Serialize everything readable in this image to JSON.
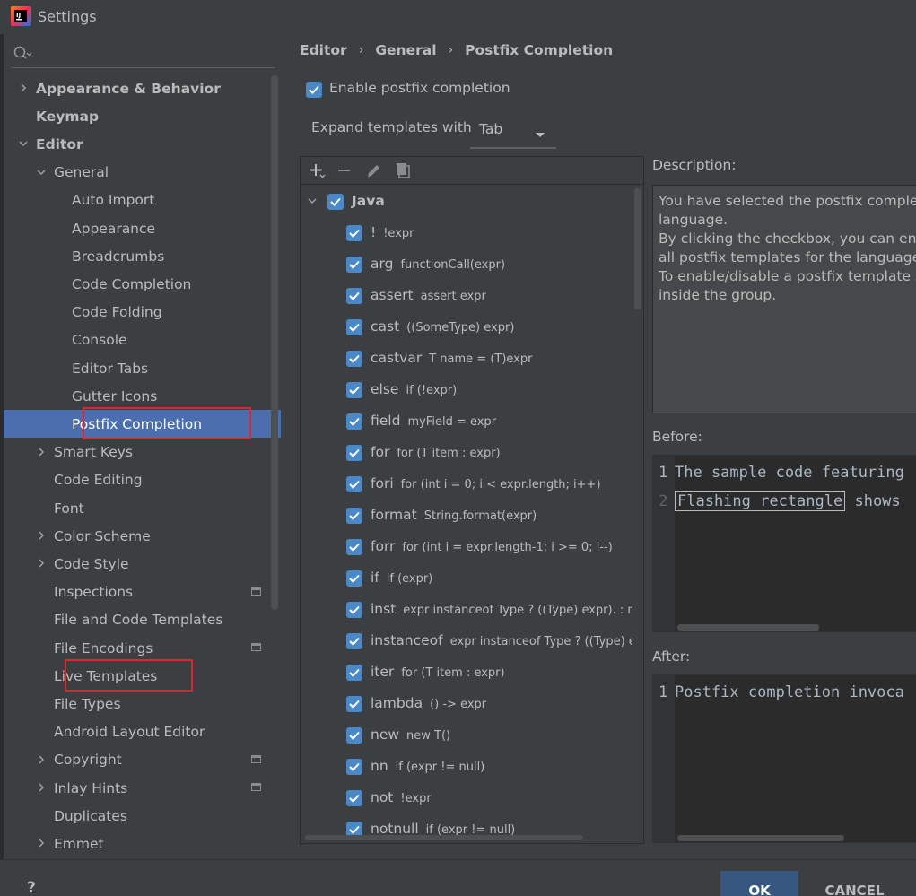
{
  "window": {
    "title": "Settings",
    "app_icon": "intellij-idea-icon"
  },
  "search": {
    "placeholder": "",
    "icon": "search-icon"
  },
  "tree": {
    "items": [
      {
        "label": "Appearance & Behavior",
        "bold": true,
        "expandable": true,
        "expanded": false
      },
      {
        "label": "Keymap",
        "bold": true,
        "expandable": false
      },
      {
        "label": "Editor",
        "bold": true,
        "expandable": true,
        "expanded": true
      },
      {
        "label": "General",
        "expandable": true,
        "expanded": true
      },
      {
        "label": "Auto Import"
      },
      {
        "label": "Appearance"
      },
      {
        "label": "Breadcrumbs"
      },
      {
        "label": "Code Completion"
      },
      {
        "label": "Code Folding"
      },
      {
        "label": "Console"
      },
      {
        "label": "Editor Tabs"
      },
      {
        "label": "Gutter Icons"
      },
      {
        "label": "Postfix Completion",
        "selected": true,
        "highlighted": true
      },
      {
        "label": "Smart Keys",
        "expandable": true,
        "expanded": false
      },
      {
        "label": "Code Editing"
      },
      {
        "label": "Font"
      },
      {
        "label": "Color Scheme",
        "expandable": true,
        "expanded": false
      },
      {
        "label": "Code Style",
        "expandable": true,
        "expanded": false
      },
      {
        "label": "Inspections",
        "badge": true
      },
      {
        "label": "File and Code Templates"
      },
      {
        "label": "File Encodings",
        "badge": true
      },
      {
        "label": "Live Templates",
        "highlighted": true
      },
      {
        "label": "File Types"
      },
      {
        "label": "Android Layout Editor"
      },
      {
        "label": "Copyright",
        "expandable": true,
        "expanded": false,
        "badge": true
      },
      {
        "label": "Inlay Hints",
        "expandable": true,
        "expanded": false,
        "badge": true
      },
      {
        "label": "Duplicates"
      },
      {
        "label": "Emmet",
        "expandable": true,
        "expanded": false
      }
    ]
  },
  "breadcrumb": [
    "Editor",
    "General",
    "Postfix Completion"
  ],
  "enable_postfix": {
    "label": "Enable postfix completion",
    "checked": true
  },
  "expand": {
    "label": "Expand templates with",
    "value": "Tab"
  },
  "toolbar": {
    "icons": [
      "add-icon",
      "remove-icon",
      "edit-icon",
      "copy-icon"
    ]
  },
  "templates": {
    "group": {
      "label": "Java",
      "checked": true,
      "expanded": true
    },
    "items": [
      {
        "key": "!",
        "example": "!expr"
      },
      {
        "key": "arg",
        "example": "functionCall(expr)"
      },
      {
        "key": "assert",
        "example": "assert expr"
      },
      {
        "key": "cast",
        "example": "((SomeType) expr)"
      },
      {
        "key": "castvar",
        "example": "T name = (T)expr"
      },
      {
        "key": "else",
        "example": "if (!expr)"
      },
      {
        "key": "field",
        "example": "myField = expr"
      },
      {
        "key": "for",
        "example": "for (T item : expr)"
      },
      {
        "key": "fori",
        "example": "for (int i = 0; i < expr.length; i++)"
      },
      {
        "key": "format",
        "example": "String.format(expr)"
      },
      {
        "key": "forr",
        "example": "for (int i = expr.length-1; i >= 0; i--)"
      },
      {
        "key": "if",
        "example": "if (expr)"
      },
      {
        "key": "inst",
        "example": "expr instanceof Type ? ((Type) expr). : null"
      },
      {
        "key": "instanceof",
        "example": "expr instanceof Type ? ((Type) expr)."
      },
      {
        "key": "iter",
        "example": "for (T item : expr)"
      },
      {
        "key": "lambda",
        "example": "() -> expr"
      },
      {
        "key": "new",
        "example": "new T()"
      },
      {
        "key": "nn",
        "example": "if (expr != null)"
      },
      {
        "key": "not",
        "example": "!expr"
      },
      {
        "key": "notnull",
        "example": "if (expr != null)"
      }
    ]
  },
  "description": {
    "label": "Description:",
    "lines": [
      "You have selected the postfix completio",
      "language.",
      "By clicking the checkbox, you can enabl",
      "all postfix templates for the language.",
      "To enable/disable a postfix template se",
      "inside the group."
    ]
  },
  "before": {
    "label": "Before:",
    "lines": [
      {
        "num": "1",
        "text": "The sample code featuring"
      },
      {
        "num": "2",
        "pre": "",
        "flash": "Flashing rectangle",
        "post": " shows"
      }
    ]
  },
  "after": {
    "label": "After:",
    "lines": [
      {
        "num": "1",
        "text": "Postfix completion invoca"
      }
    ]
  },
  "buttons": {
    "help": "?",
    "ok": "OK",
    "cancel": "CANCEL"
  },
  "colors": {
    "selection": "#4b6eaf",
    "checkbox": "#4a88c7",
    "highlight_box": "#e0252f",
    "ok_button": "#365880"
  }
}
